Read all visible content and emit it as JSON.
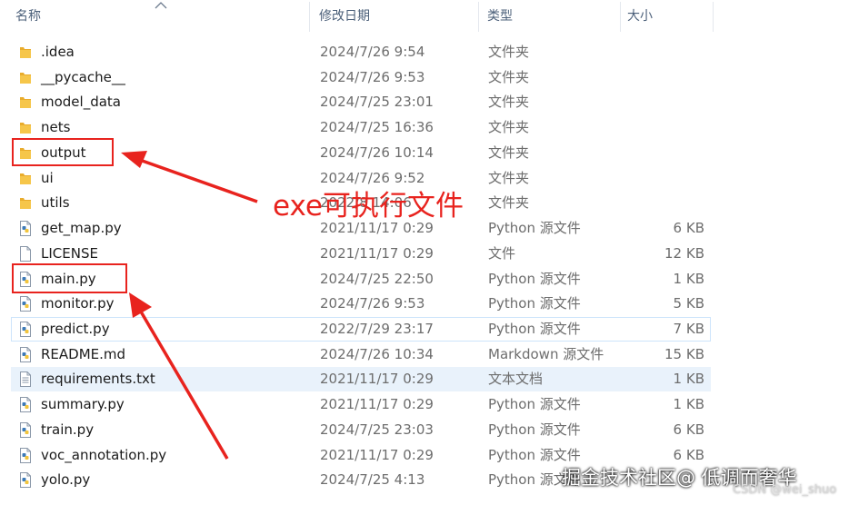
{
  "columns": {
    "name": "名称",
    "date": "修改日期",
    "type": "类型",
    "size": "大小"
  },
  "rows": [
    {
      "name": ".idea",
      "date": "2024/7/26 9:54",
      "type": "文件夹",
      "size": "",
      "icon": "folder-icon"
    },
    {
      "name": "__pycache__",
      "date": "2024/7/26 9:53",
      "type": "文件夹",
      "size": "",
      "icon": "folder-icon"
    },
    {
      "name": "model_data",
      "date": "2024/7/25 23:01",
      "type": "文件夹",
      "size": "",
      "icon": "folder-icon"
    },
    {
      "name": "nets",
      "date": "2024/7/25 16:36",
      "type": "文件夹",
      "size": "",
      "icon": "folder-icon"
    },
    {
      "name": "output",
      "date": "2024/7/26 10:14",
      "type": "文件夹",
      "size": "",
      "icon": "folder-icon"
    },
    {
      "name": "ui",
      "date": "2024/7/26 9:52",
      "type": "文件夹",
      "size": "",
      "icon": "folder-icon"
    },
    {
      "name": "utils",
      "date": "2022/8 14:06",
      "type": "文件夹",
      "size": "",
      "icon": "folder-icon"
    },
    {
      "name": "get_map.py",
      "date": "2021/11/17 0:29",
      "type": "Python 源文件",
      "size": "6 KB",
      "icon": "python-file-icon"
    },
    {
      "name": "LICENSE",
      "date": "2021/11/17 0:29",
      "type": "文件",
      "size": "12 KB",
      "icon": "file-icon"
    },
    {
      "name": "main.py",
      "date": "2024/7/25 22:50",
      "type": "Python 源文件",
      "size": "1 KB",
      "icon": "python-file-icon"
    },
    {
      "name": "monitor.py",
      "date": "2024/7/26 9:53",
      "type": "Python 源文件",
      "size": "5 KB",
      "icon": "python-file-icon"
    },
    {
      "name": "predict.py",
      "date": "2022/7/29 23:17",
      "type": "Python 源文件",
      "size": "7 KB",
      "icon": "python-file-icon"
    },
    {
      "name": "README.md",
      "date": "2024/7/26 10:34",
      "type": "Markdown 源文件",
      "size": "15 KB",
      "icon": "markdown-file-icon"
    },
    {
      "name": "requirements.txt",
      "date": "2021/11/17 0:29",
      "type": "文本文档",
      "size": "1 KB",
      "icon": "text-file-icon"
    },
    {
      "name": "summary.py",
      "date": "2021/11/17 0:29",
      "type": "Python 源文件",
      "size": "1 KB",
      "icon": "python-file-icon"
    },
    {
      "name": "train.py",
      "date": "2024/7/25 23:03",
      "type": "Python 源文件",
      "size": "6 KB",
      "icon": "python-file-icon"
    },
    {
      "name": "voc_annotation.py",
      "date": "2021/11/17 0:29",
      "type": "Python 源文件",
      "size": "6 KB",
      "icon": "python-file-icon"
    },
    {
      "name": "yolo.py",
      "date": "2024/7/25 4:13",
      "type": "Python 源文件",
      "size": "",
      "icon": "python-file-icon"
    }
  ],
  "annotation": {
    "label": "exe可执行文件",
    "color": "#e8231e"
  },
  "watermark": {
    "main": "掘金技术社区@ 低调而奢华",
    "sub": "CSDN @wei_shuo"
  },
  "colors": {
    "header_text": "#4c607a",
    "hover_row": "#f0f5fb",
    "selected_row": "#e9f2fb",
    "annotation": "#e8231e",
    "folder": "#f6c64a"
  }
}
